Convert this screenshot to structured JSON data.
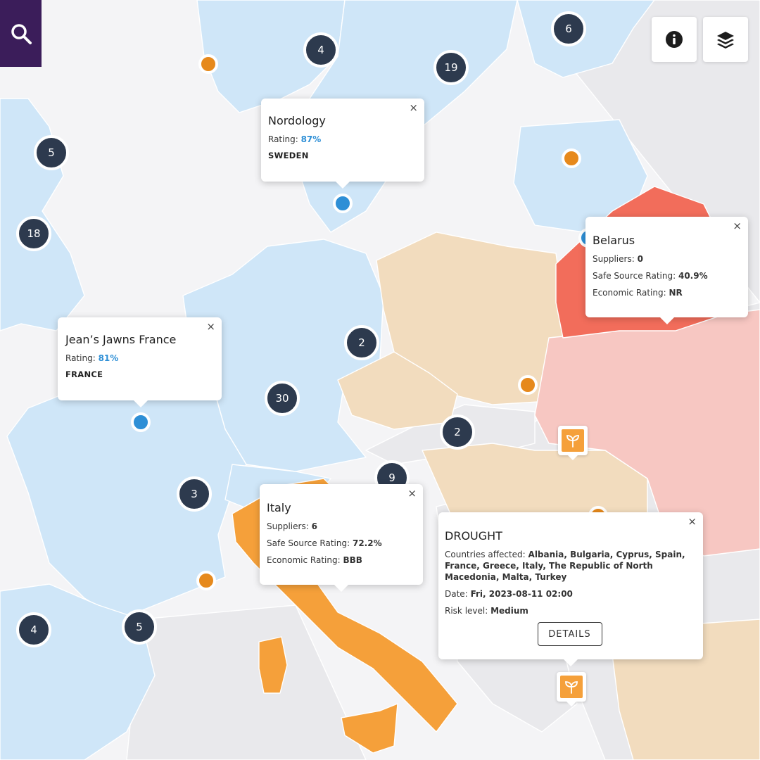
{
  "colors": {
    "sea": "#f4f4f6",
    "land_neutral": "#e9e9ec",
    "land_supplier": "#cfe6f8",
    "risk_high": "#f26d5b",
    "risk_elevated": "#f7c7c2",
    "risk_drought": "#f5a03a",
    "risk_light": "#f2dcbe",
    "cluster": "#2d3a4e",
    "supplier_dot": "#2e8fd6",
    "event_dot": "#e6891c",
    "search_bg": "#3b1d5a"
  },
  "controls": {
    "search_icon": "search-icon",
    "info_icon": "info-icon",
    "layers_icon": "layers-icon"
  },
  "clusters": [
    "6",
    "4",
    "19",
    "5",
    "18",
    "2",
    "30",
    "2",
    "3",
    "9",
    "4",
    "5"
  ],
  "popups": {
    "nordology": {
      "title": "Nordology",
      "rating_label": "Rating:",
      "rating_value": "87%",
      "country": "SWEDEN",
      "close": "×"
    },
    "france": {
      "title": "Jean’s Jawns France",
      "rating_label": "Rating:",
      "rating_value": "81%",
      "country": "FRANCE",
      "close": "×"
    },
    "belarus": {
      "title": "Belarus",
      "suppliers_label": "Suppliers:",
      "suppliers_value": "0",
      "safe_label": "Safe Source Rating:",
      "safe_value": "40.9%",
      "economic_label": "Economic Rating:",
      "economic_value": "NR",
      "close": "×"
    },
    "italy": {
      "title": "Italy",
      "suppliers_label": "Suppliers:",
      "suppliers_value": "6",
      "safe_label": "Safe Source Rating:",
      "safe_value": "72.2%",
      "economic_label": "Economic Rating:",
      "economic_value": "BBB",
      "close": "×"
    },
    "drought": {
      "title": "DROUGHT",
      "countries_label": "Countries affected:",
      "countries_value": "Albania, Bulgaria, Cyprus, Spain, France, Greece, Italy, The Republic of North Macedonia, Malta, Turkey",
      "date_label": "Date:",
      "date_value": "Fri, 2023-08-11 02:00",
      "risk_label": "Risk level:",
      "risk_value": "Medium",
      "details_button": "DETAILS",
      "close": "×"
    }
  },
  "event_markers": {
    "icon": "sprout-icon"
  }
}
